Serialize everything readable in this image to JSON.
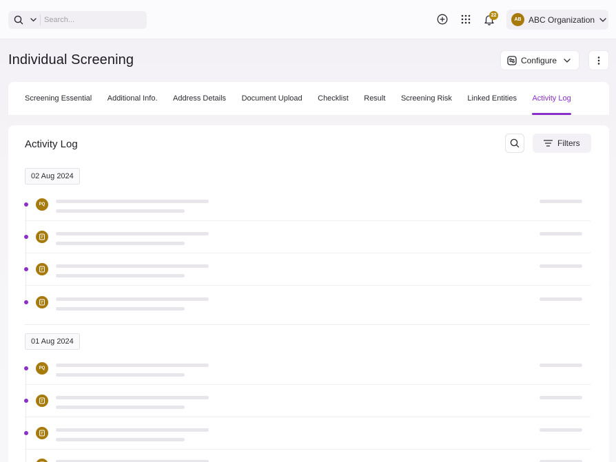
{
  "topbar": {
    "search_placeholder": "Search...",
    "notification_count": "22",
    "org_initials": "AB",
    "org_name": "ABC Organization"
  },
  "header": {
    "title": "Individual Screening",
    "configure_label": "Configure"
  },
  "tabs": [
    {
      "label": "Screening Essential",
      "active": false
    },
    {
      "label": "Additional Info.",
      "active": false
    },
    {
      "label": "Address Details",
      "active": false
    },
    {
      "label": "Document Upload",
      "active": false
    },
    {
      "label": "Checklist",
      "active": false
    },
    {
      "label": "Result",
      "active": false
    },
    {
      "label": "Screening Risk",
      "active": false
    },
    {
      "label": "Linked Entities",
      "active": false
    },
    {
      "label": "Activity Log",
      "active": true
    }
  ],
  "activity_log": {
    "title": "Activity Log",
    "filters_label": "Filters",
    "groups": [
      {
        "date": "02 Aug 2024",
        "entries": [
          {
            "icon": "initials",
            "initials": "PQ"
          },
          {
            "icon": "document-icon"
          },
          {
            "icon": "document-icon"
          },
          {
            "icon": "document-icon"
          }
        ]
      },
      {
        "date": "01 Aug 2024",
        "entries": [
          {
            "icon": "initials",
            "initials": "PQ"
          },
          {
            "icon": "document-icon"
          },
          {
            "icon": "document-icon"
          },
          {
            "icon": "document-icon"
          }
        ]
      }
    ]
  },
  "colors": {
    "accent": "#8b2fc9",
    "avatar": "#a77a0c",
    "skeleton": "#e8e6ea"
  }
}
